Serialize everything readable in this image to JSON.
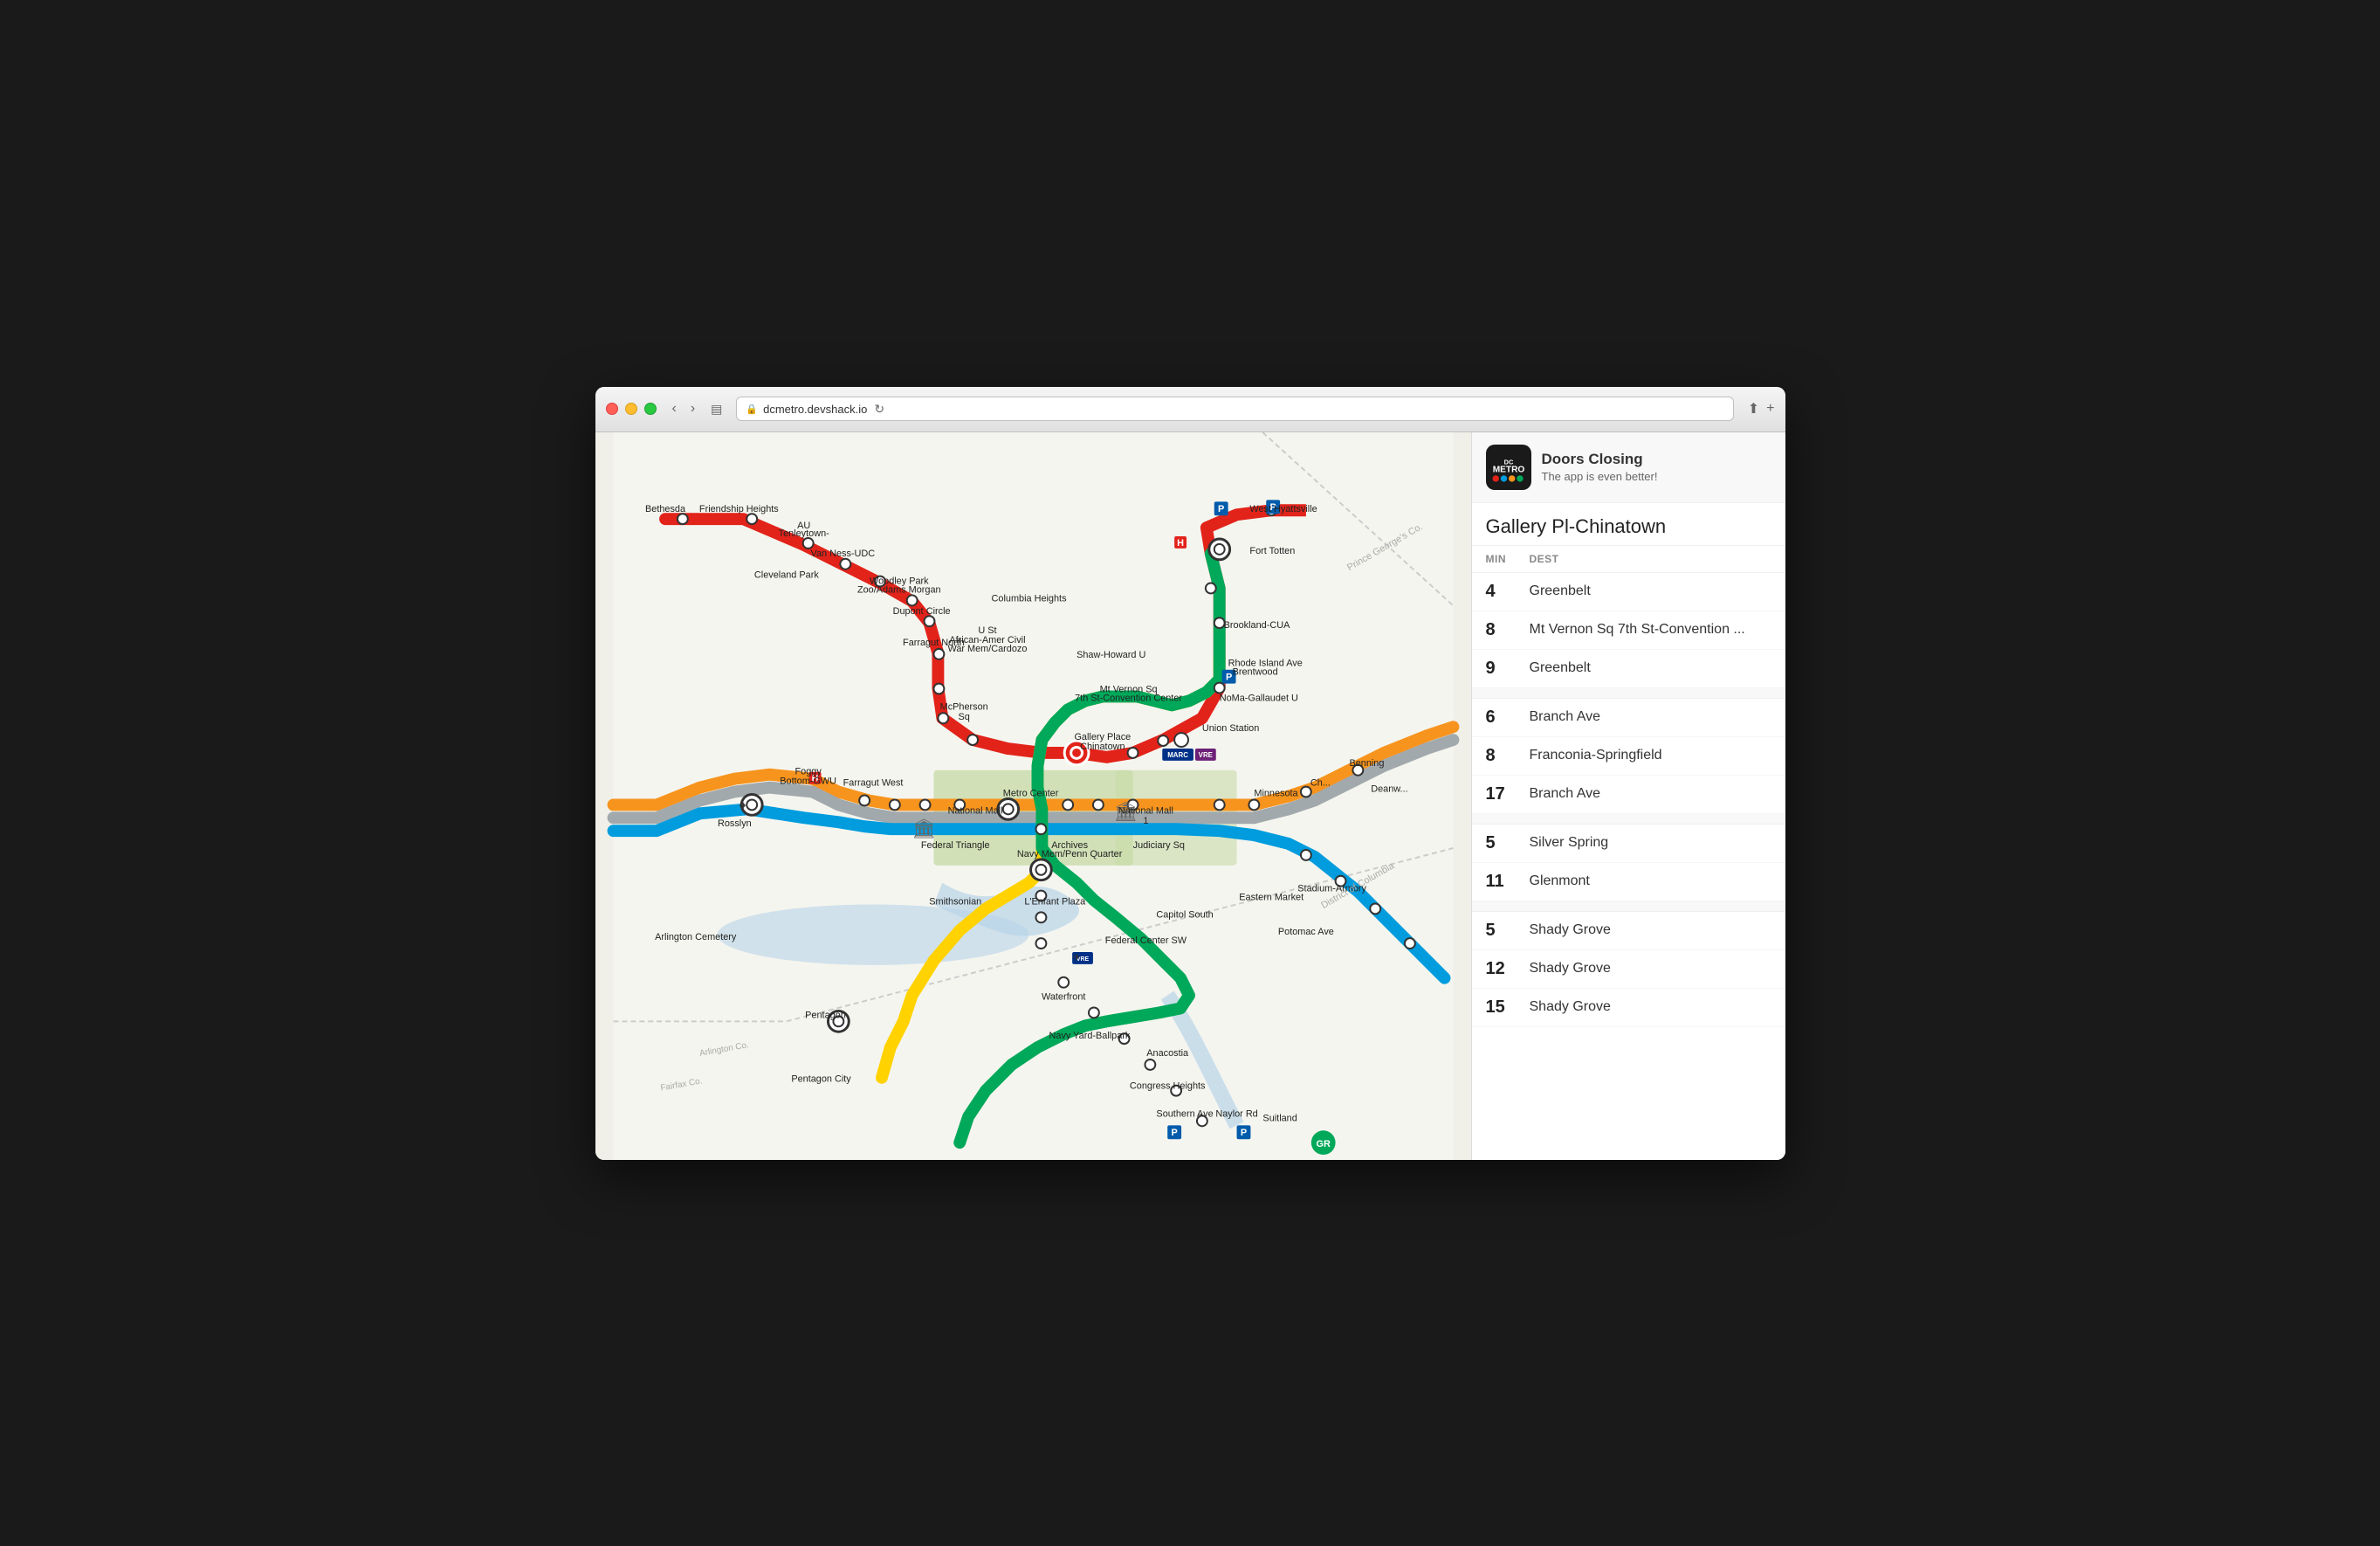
{
  "browser": {
    "url": "dcmetro.devshack.io",
    "url_display": "🔒 dcmetro.devshack.io"
  },
  "app": {
    "title": "Doors Closing",
    "subtitle": "The app is even better!"
  },
  "station": {
    "name": "Gallery Pl-Chinatown"
  },
  "arrivals_headers": {
    "min": "MIN",
    "dest": "DEST"
  },
  "arrivals": [
    {
      "min": "4",
      "dest": "Greenbelt",
      "group": 1
    },
    {
      "min": "8",
      "dest": "Mt Vernon Sq 7th St-Convention ...",
      "group": 1
    },
    {
      "min": "9",
      "dest": "Greenbelt",
      "group": 1
    },
    {
      "min": "6",
      "dest": "Branch Ave",
      "group": 2
    },
    {
      "min": "8",
      "dest": "Franconia-Springfield",
      "group": 2
    },
    {
      "min": "17",
      "dest": "Branch Ave",
      "group": 2
    },
    {
      "min": "5",
      "dest": "Silver Spring",
      "group": 3
    },
    {
      "min": "11",
      "dest": "Glenmont",
      "group": 3
    },
    {
      "min": "5",
      "dest": "Shady Grove",
      "group": 4
    },
    {
      "min": "12",
      "dest": "Shady Grove",
      "group": 4
    },
    {
      "min": "15",
      "dest": "Shady Grove",
      "group": 4
    }
  ],
  "map": {
    "stations": [
      "Bethesda",
      "Friendship Heights",
      "Tenleytown-AU",
      "Van Ness-UDC",
      "Cleveland Park",
      "Woodley Park Zoo/Adams Morgan",
      "Dupont Circle",
      "Farragut North",
      "Columbia Heights",
      "U St African-Amer Civil War Mem/Cardozo",
      "Shaw-Howard U",
      "Mt Vernon Sq 7th St-Convention Center",
      "Gallery Place Chinatown",
      "McPherson Sq",
      "Farragut West",
      "Foggy Bottom-GWU",
      "Rosslyn",
      "Fort Totten",
      "Brookland-CUA",
      "Rhode Island Ave Brentwood",
      "NoMa-Gallaudet U",
      "Union Station",
      "West Hyattsville",
      "National Mall",
      "Metro Center",
      "Federal Triangle",
      "Smithsonian",
      "Archives Navy Mem/Penn Quarter",
      "L'Enfant Plaza",
      "Judiciary Sq",
      "Capitol South",
      "Federal Center SW",
      "Eastern Market",
      "Potomac Ave",
      "Stadium-Armory",
      "Benning",
      "Minnesota",
      "Anacostia",
      "Congress Heights",
      "Southern Ave",
      "Naylor Rd",
      "Suitland",
      "Waterfront",
      "Navy Yard-Ballpark",
      "Arlington Cemetery",
      "Pentagon",
      "Pentagon City",
      "Branch Ave",
      "Franconia-Springfield",
      "Greenbelt",
      "Glenmont",
      "Silver Spring",
      "Shady Grove"
    ]
  }
}
